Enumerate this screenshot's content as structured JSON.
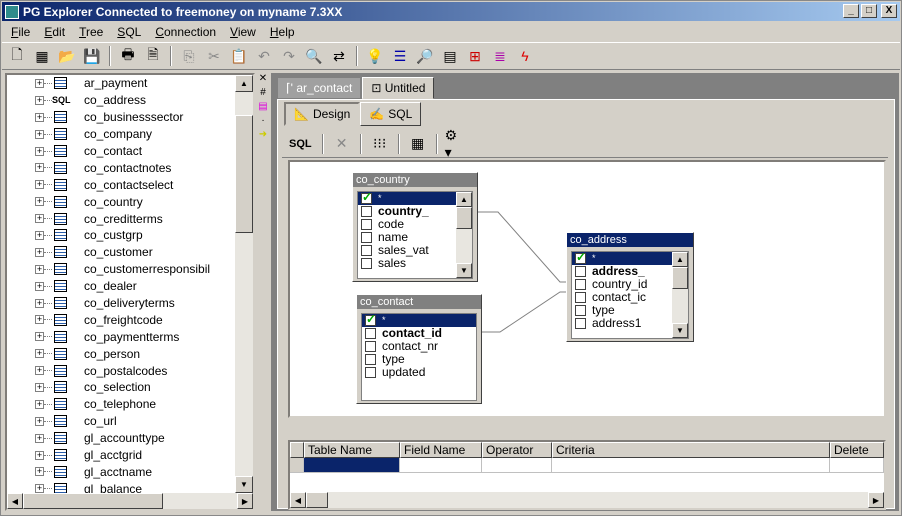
{
  "window": {
    "title": "PG Explorer Connected to freemoney on myname 7.3XX",
    "controls": [
      "_",
      "□",
      "X"
    ]
  },
  "menu": [
    "File",
    "Edit",
    "Tree",
    "SQL",
    "Connection",
    "View",
    "Help"
  ],
  "toolbar_icons": [
    "new-icon",
    "db-icon",
    "open-icon",
    "save-icon",
    "print-icon",
    "preview-icon",
    "copy-icon",
    "cut-icon",
    "paste-icon",
    "undo-icon",
    "redo-icon",
    "find-icon",
    "replace-icon",
    "hint-icon",
    "table-icon",
    "view-icon",
    "form-icon",
    "schema-icon",
    "sequence-icon",
    "function-icon"
  ],
  "tree": [
    "ar_payment",
    "co_address",
    "co_businesssector",
    "co_company",
    "co_contact",
    "co_contactnotes",
    "co_contactselect",
    "co_country",
    "co_creditterms",
    "co_custgrp",
    "co_customer",
    "co_customerresponsibil",
    "co_dealer",
    "co_deliveryterms",
    "co_freightcode",
    "co_paymentterms",
    "co_person",
    "co_postalcodes",
    "co_selection",
    "co_telephone",
    "co_url",
    "gl_accounttype",
    "gl_acctgrid",
    "gl_acctname",
    "gl_balance"
  ],
  "tabs": [
    "ar_contact",
    "Untitled"
  ],
  "subtabs": {
    "design": "Design",
    "sql": "SQL"
  },
  "query_toolbar": {
    "sql_label": "SQL"
  },
  "tables": {
    "co_country": {
      "name": "co_country",
      "fields": [
        "*",
        "country_",
        "code",
        "name",
        "sales_vat",
        "sales"
      ]
    },
    "co_contact": {
      "name": "co_contact",
      "fields": [
        "*",
        "contact_id",
        "contact_nr",
        "type",
        "updated"
      ]
    },
    "co_address": {
      "name": "co_address",
      "fields": [
        "*",
        "address_",
        "country_id",
        "contact_ic",
        "type",
        "address1"
      ]
    }
  },
  "grid": {
    "columns": [
      "Table Name",
      "Field Name",
      "Operator",
      "Criteria",
      "Delete"
    ]
  }
}
